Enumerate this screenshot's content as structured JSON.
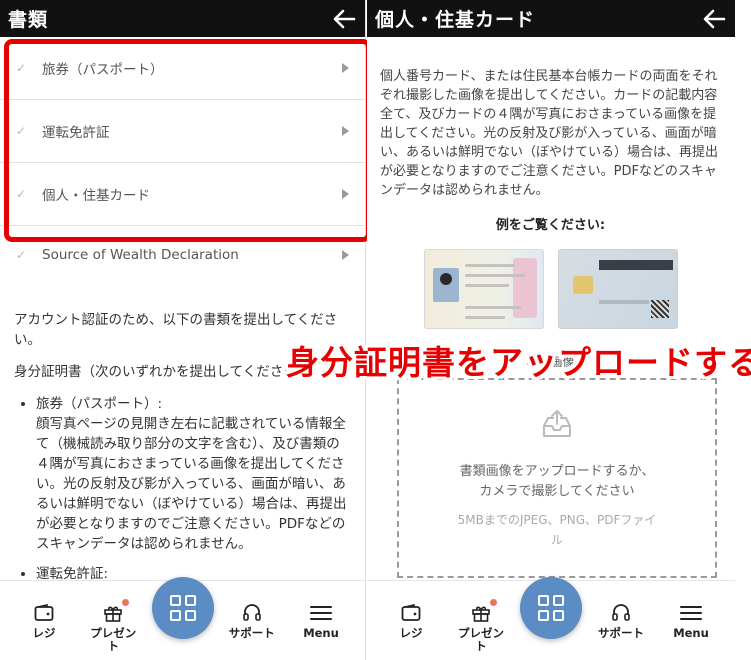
{
  "left": {
    "header_title": "書類",
    "items": [
      {
        "label": "旅券（パスポート）"
      },
      {
        "label": "運転免許証"
      },
      {
        "label": "個人・住基カード"
      },
      {
        "label": "Source of Wealth Declaration"
      }
    ],
    "intro": "アカウント認証のため、以下の書類を提出してください。",
    "id_heading": "身分証明書（次のいずれかを提出してください）",
    "list": [
      {
        "title": "旅券（パスポート）:",
        "desc": "顔写真ページの見開き左右に記載されている情報全て（機械読み取り部分の文字を含む）、及び書類の４隅が写真におさまっている画像を提出してください。光の反射及び影が入っている、画面が暗い、あるいは鮮明でない（ぼやけている）場合は、再提出が必要となりますのでご注意ください。PDFなどのスキャンデータは認められません。"
      },
      {
        "title": "運転免許証:",
        "desc": ""
      }
    ]
  },
  "right": {
    "header_title": "個人・住基カード",
    "description": "個人番号カード、または住民基本台帳カードの両面をそれぞれ撮影した画像を提出してください。カードの記載内容全て、及びカードの４隅が写真におさまっている画像を提出してください。光の反射及び影が入っている、画面が暗い、あるいは鮮明でない（ぼやけている）場合は、再提出が必要となりますのでご注意ください。PDFなどのスキャンデータは認められません。",
    "example_title": "例をご覧ください:",
    "front_label": "表面画像",
    "upload_text": "書類画像をアップロードするか、カメラで撮影してください",
    "upload_sub": "5MBまでのJPEG、PNG、PDFファイル"
  },
  "nav": {
    "register": "レジ",
    "present": "プレゼント",
    "support": "サポート",
    "menu": "Menu"
  },
  "banner": "身分証明書をアップロードする",
  "colors": {
    "highlight": "#e60000",
    "accent": "#5b8dc4",
    "header_bg": "#111111",
    "badge": "#e8775c"
  }
}
